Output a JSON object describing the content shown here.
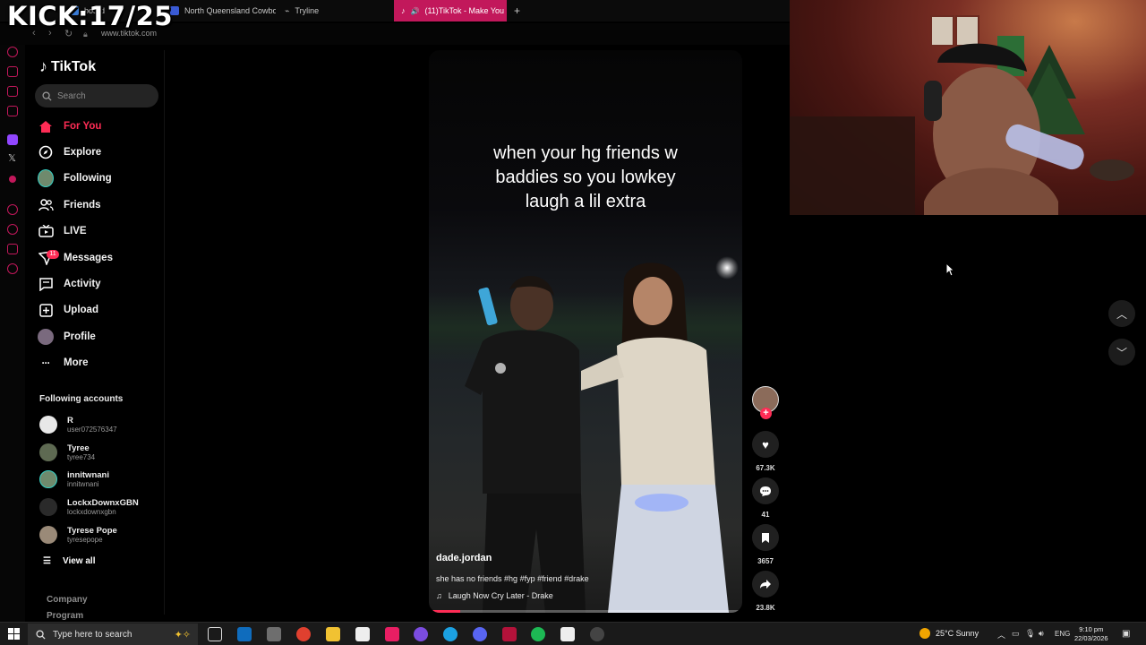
{
  "overlay": {
    "kick_counter": "KICK:17/25"
  },
  "browser": {
    "tabs": [
      {
        "label": "board",
        "color": "#3a7bd5"
      },
      {
        "label": "North Queensland Cowbo",
        "color": "#3a5bd5"
      },
      {
        "label": "Tryline",
        "color": "#888888"
      },
      {
        "label": "(11)TikTok - Make You",
        "color": "#ffffff"
      }
    ],
    "new_tab_label": "+",
    "url": "www.tiktok.com"
  },
  "tiktok": {
    "logo_text": "TikTok",
    "search_placeholder": "Search",
    "nav": [
      {
        "label": "For You",
        "icon": "home-icon"
      },
      {
        "label": "Explore",
        "icon": "compass-icon"
      },
      {
        "label": "Following",
        "icon": "following-avatar"
      },
      {
        "label": "Friends",
        "icon": "friends-icon"
      },
      {
        "label": "LIVE",
        "icon": "live-icon"
      },
      {
        "label": "Messages",
        "icon": "messages-icon"
      },
      {
        "label": "Activity",
        "icon": "activity-icon"
      },
      {
        "label": "Upload",
        "icon": "upload-icon"
      },
      {
        "label": "Profile",
        "icon": "profile-avatar"
      },
      {
        "label": "More",
        "icon": "more-icon"
      }
    ],
    "messages_badge": "11",
    "following_accounts_title": "Following accounts",
    "accounts": [
      {
        "name": "R",
        "username": "user072576347"
      },
      {
        "name": "Tyree",
        "username": "tyree734"
      },
      {
        "name": "innitwnani",
        "username": "innitwnani"
      },
      {
        "name": "LockxDownxGBN",
        "username": "lockxdownxgbn"
      },
      {
        "name": "Tyrese Pope",
        "username": "tyresepope"
      }
    ],
    "view_all": "View all",
    "footer_links": [
      "Company",
      "Program"
    ]
  },
  "video": {
    "caption_lines": [
      "when your hg friends w",
      "baddies so you lowkey",
      "laugh a lil extra"
    ],
    "author": "dade.jordan",
    "description": "she has no friends #hg #fyp #friend #drake",
    "music": "Laugh Now Cry Later - Drake",
    "progress": 0.1,
    "likes": "67.3K",
    "comments": "41",
    "saves": "3657",
    "shares": "23.8K"
  },
  "taskbar": {
    "search_placeholder": "Type here to search",
    "weather": "25°C  Sunny",
    "language": "ENG",
    "time": "9:10 pm",
    "date": "22/03/2026"
  },
  "colors": {
    "accent": "#fe2c55",
    "tab_active": "#c2185b",
    "background": "#000000"
  }
}
